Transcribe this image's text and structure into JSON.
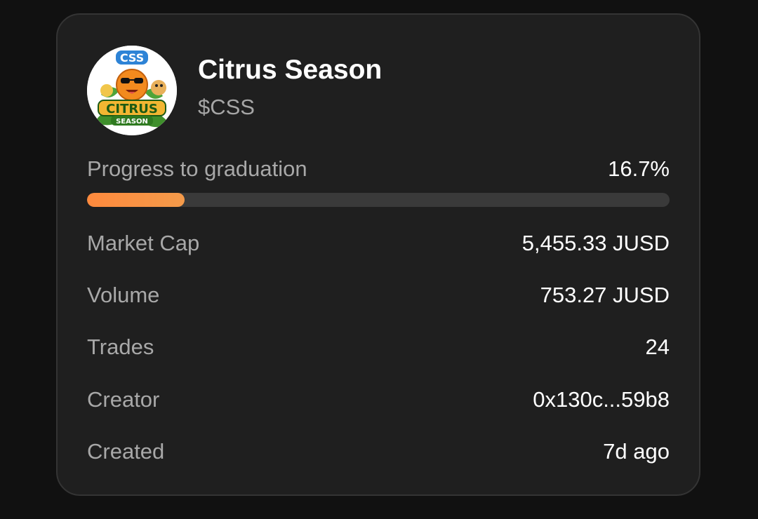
{
  "token": {
    "name": "Citrus Season",
    "symbol": "$CSS",
    "avatar_icon": "citrus-season-logo",
    "avatar_text": [
      "CSS",
      "CITRUS",
      "SEASON"
    ]
  },
  "progress": {
    "label": "Progress to graduation",
    "value_text": "16.7%",
    "value": 0.167,
    "fill_color": "#f2863d"
  },
  "stats": [
    {
      "label": "Market Cap",
      "value": "5,455.33 JUSD"
    },
    {
      "label": "Volume",
      "value": "753.27 JUSD"
    },
    {
      "label": "Trades",
      "value": "24"
    },
    {
      "label": "Creator",
      "value": "0x130c...59b8"
    },
    {
      "label": "Created",
      "value": "7d ago"
    }
  ]
}
